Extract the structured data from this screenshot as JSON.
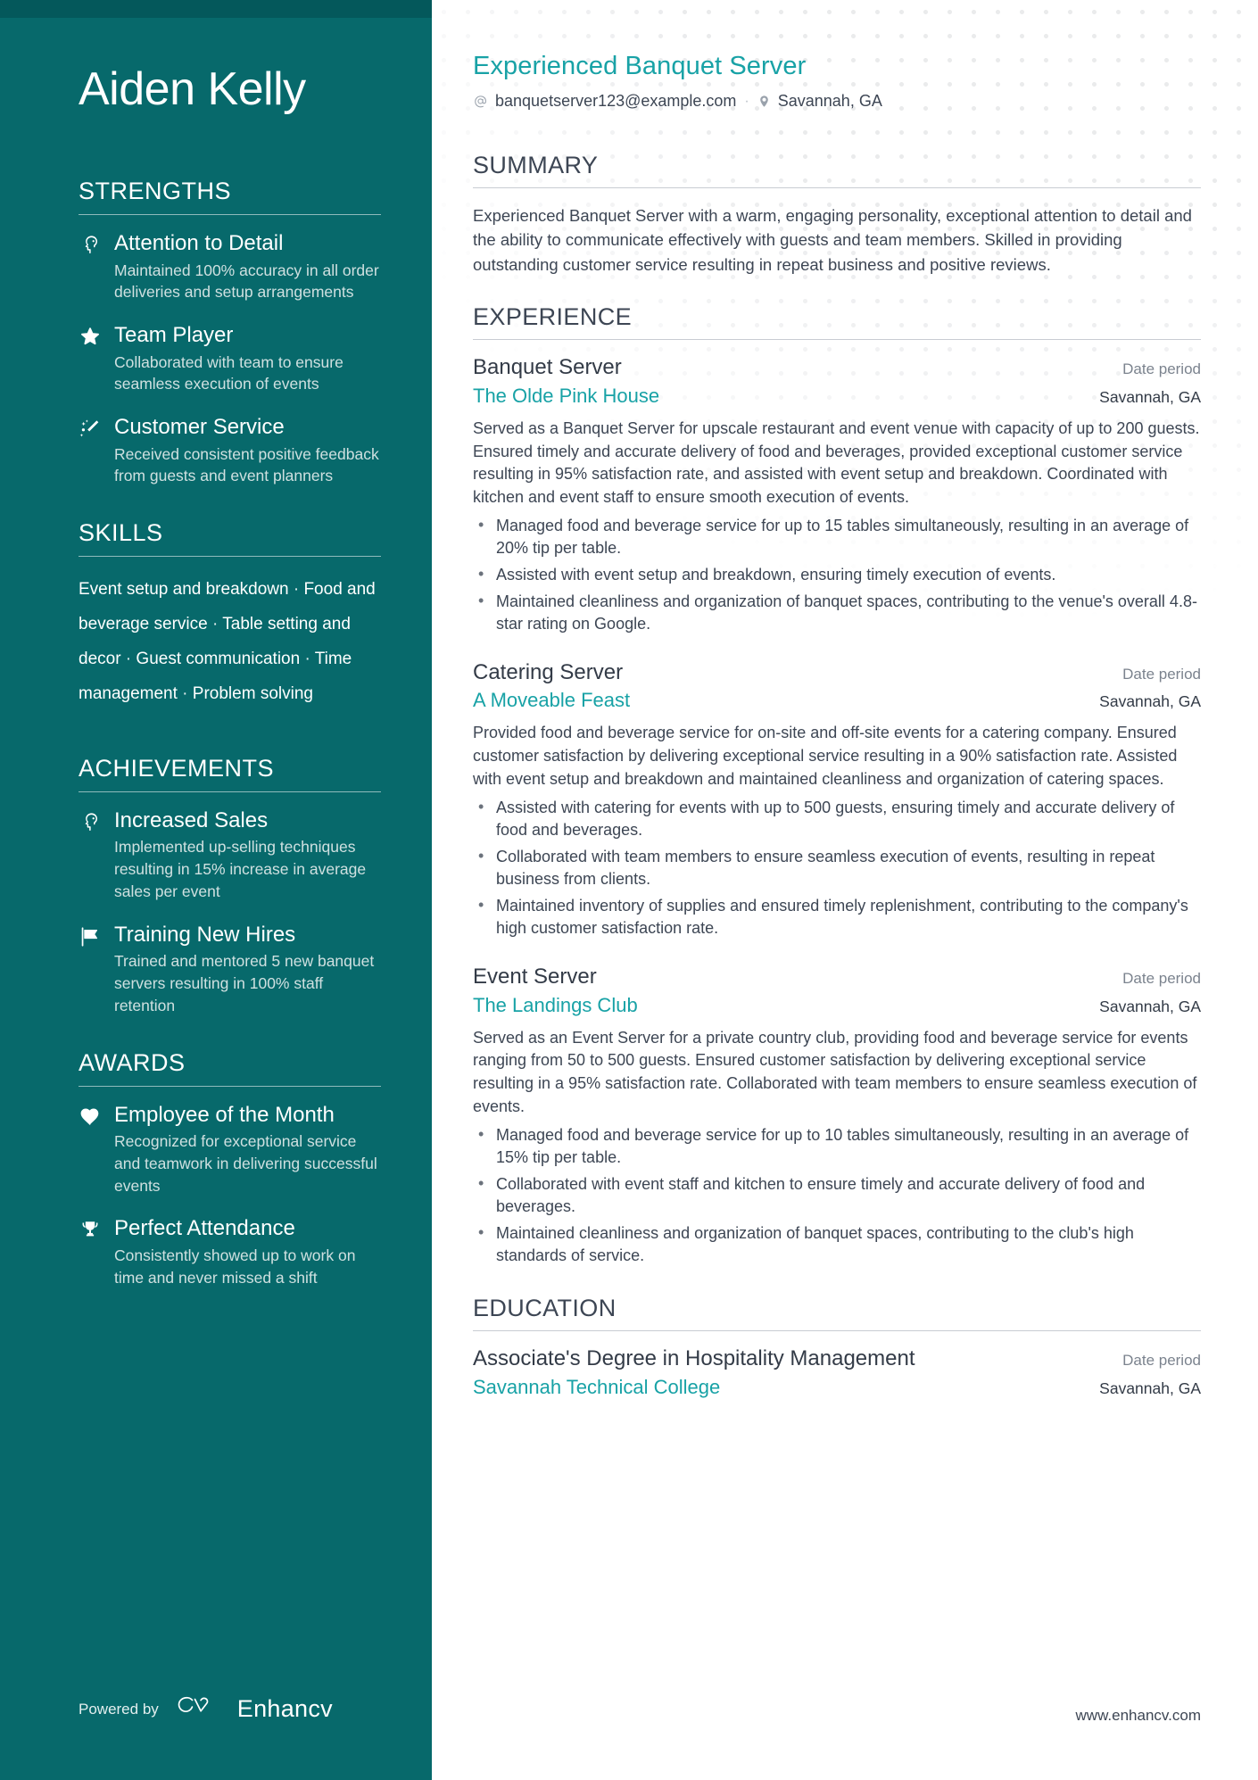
{
  "sidebar": {
    "name": "Aiden Kelly",
    "sections": {
      "strengths": {
        "title": "STRENGTHS",
        "items": [
          {
            "icon": "mind-head-icon",
            "title": "Attention to Detail",
            "desc": "Maintained 100% accuracy in all order deliveries and setup arrangements"
          },
          {
            "icon": "star-icon",
            "title": "Team Player",
            "desc": "Collaborated with team to ensure seamless execution of events"
          },
          {
            "icon": "sparkle-wand-icon",
            "title": "Customer Service",
            "desc": "Received consistent positive feedback from guests and event planners"
          }
        ]
      },
      "skills": {
        "title": "SKILLS",
        "items": [
          "Event setup and breakdown",
          "Food and beverage service",
          "Table setting and decor",
          "Guest communication",
          "Time management",
          "Problem solving"
        ],
        "separator": "·"
      },
      "achievements": {
        "title": "ACHIEVEMENTS",
        "items": [
          {
            "icon": "mind-head-icon",
            "title": "Increased Sales",
            "desc": "Implemented up-selling techniques resulting in 15% increase in average sales per event"
          },
          {
            "icon": "flag-icon",
            "title": "Training New Hires",
            "desc": "Trained and mentored 5 new banquet servers resulting in 100% staff retention"
          }
        ]
      },
      "awards": {
        "title": "AWARDS",
        "items": [
          {
            "icon": "heart-icon",
            "title": "Employee of the Month",
            "desc": "Recognized for exceptional service and teamwork in delivering successful events"
          },
          {
            "icon": "trophy-icon",
            "title": "Perfect Attendance",
            "desc": "Consistently showed up to work on time and never missed a shift"
          }
        ]
      }
    },
    "footer": {
      "powered_by": "Powered by",
      "brand": "Enhancv",
      "logo_icon": "enhancv-cv-logo-icon"
    }
  },
  "main": {
    "headline": "Experienced Banquet Server",
    "contact": {
      "email": "banquetserver123@example.com",
      "email_icon": "at-sign-icon",
      "location": "Savannah, GA",
      "location_icon": "map-pin-icon",
      "separator": "·"
    },
    "summary": {
      "title": "SUMMARY",
      "text": "Experienced Banquet Server with a warm, engaging personality, exceptional attention to detail and the ability to communicate effectively with guests and team members. Skilled in providing outstanding customer service resulting in repeat business and positive reviews."
    },
    "experience": {
      "title": "EXPERIENCE",
      "entries": [
        {
          "role": "Banquet Server",
          "date": "Date period",
          "company": "The Olde Pink House",
          "location": "Savannah, GA",
          "desc": "Served as a Banquet Server for upscale restaurant and event venue with capacity of up to 200 guests. Ensured timely and accurate delivery of food and beverages, provided exceptional customer service resulting in 95% satisfaction rate, and assisted with event setup and breakdown. Coordinated with kitchen and event staff to ensure smooth execution of events.",
          "bullets": [
            "Managed food and beverage service for up to 15 tables simultaneously, resulting in an average of 20% tip per table.",
            "Assisted with event setup and breakdown, ensuring timely execution of events.",
            "Maintained cleanliness and organization of banquet spaces, contributing to the venue's overall 4.8-star rating on Google."
          ]
        },
        {
          "role": "Catering Server",
          "date": "Date period",
          "company": "A Moveable Feast",
          "location": "Savannah, GA",
          "desc": "Provided food and beverage service for on-site and off-site events for a catering company. Ensured customer satisfaction by delivering exceptional service resulting in a 90% satisfaction rate. Assisted with event setup and breakdown and maintained cleanliness and organization of catering spaces.",
          "bullets": [
            "Assisted with catering for events with up to 500 guests, ensuring timely and accurate delivery of food and beverages.",
            "Collaborated with team members to ensure seamless execution of events, resulting in repeat business from clients.",
            "Maintained inventory of supplies and ensured timely replenishment, contributing to the company's high customer satisfaction rate."
          ]
        },
        {
          "role": "Event Server",
          "date": "Date period",
          "company": "The Landings Club",
          "location": "Savannah, GA",
          "desc": "Served as an Event Server for a private country club, providing food and beverage service for events ranging from 50 to 500 guests. Ensured customer satisfaction by delivering exceptional service resulting in a 95% satisfaction rate. Collaborated with team members to ensure seamless execution of events.",
          "bullets": [
            "Managed food and beverage service for up to 10 tables simultaneously, resulting in an average of 15% tip per table.",
            "Collaborated with event staff and kitchen to ensure timely and accurate delivery of food and beverages.",
            "Maintained cleanliness and organization of banquet spaces, contributing to the club's high standards of service."
          ]
        }
      ]
    },
    "education": {
      "title": "EDUCATION",
      "entries": [
        {
          "degree": "Associate's Degree in Hospitality Management",
          "date": "Date period",
          "school": "Savannah Technical College",
          "location": "Savannah, GA"
        }
      ]
    },
    "footer_url": "www.enhancv.com"
  },
  "colors": {
    "sidebar_bg": "#07696b",
    "accent": "#18a2a6",
    "body_text": "#3d4654",
    "muted_text": "#7b838e"
  }
}
